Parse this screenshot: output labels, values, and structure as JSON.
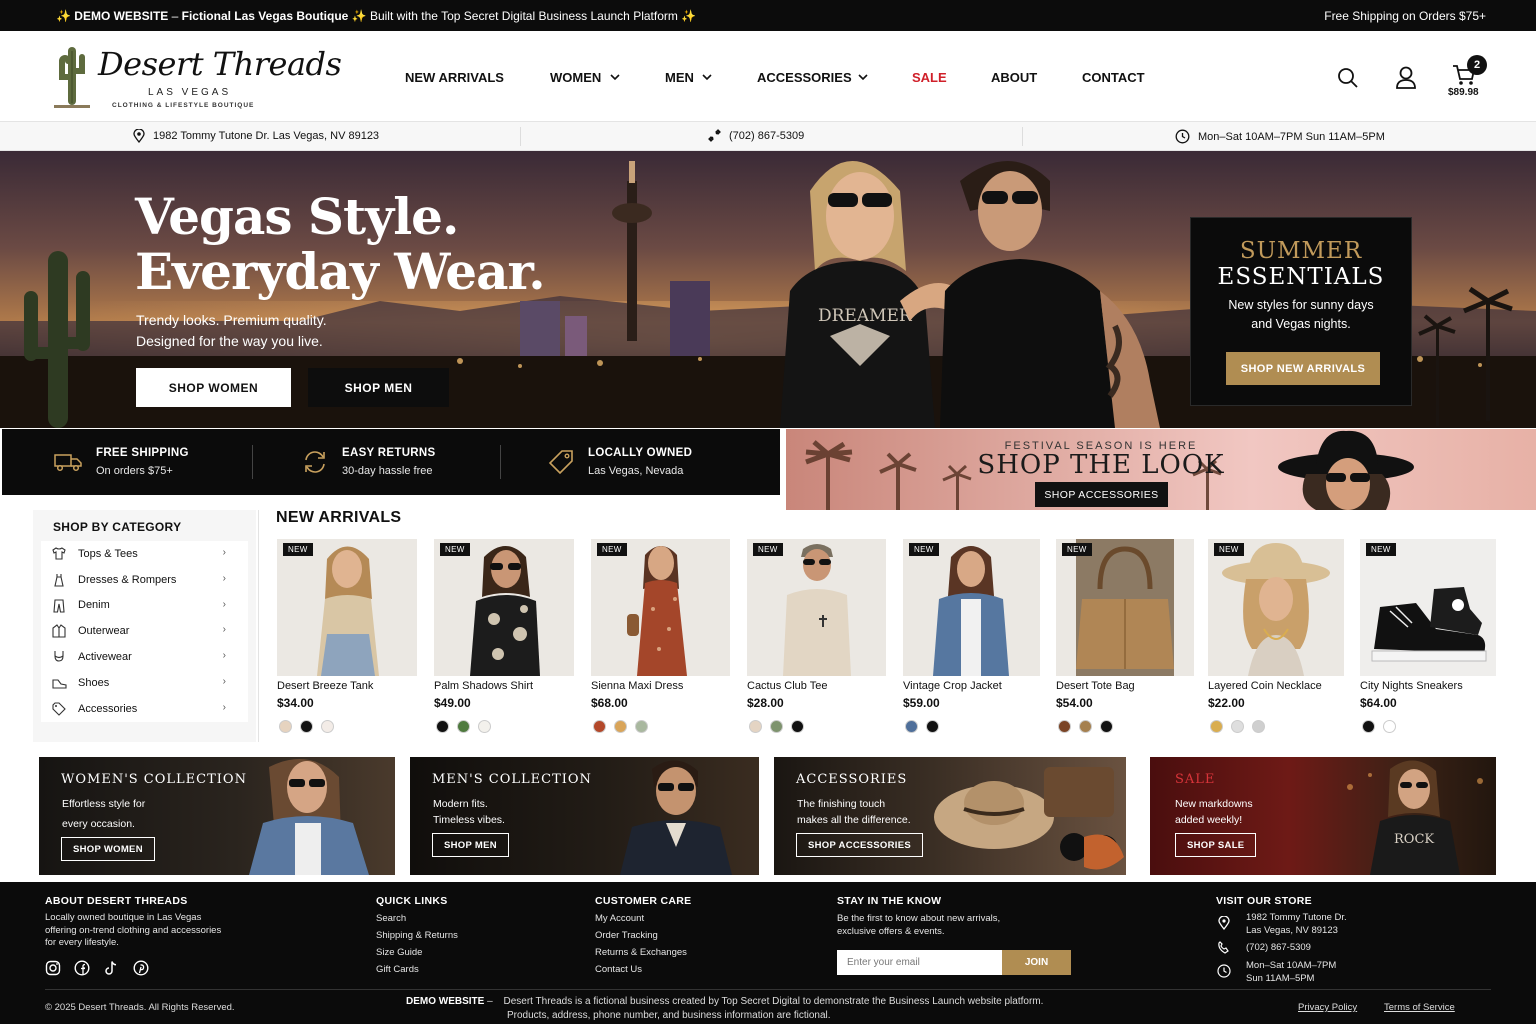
{
  "topbar": {
    "demo_prefix": "✨ DEMO WEBSITE",
    "demo_dash": " – ",
    "demo_name": "Fictional Las Vegas Boutique",
    "demo_suffix": " ✨ Built with the Top Secret Digital Business Launch Platform ✨",
    "shipping": "Free Shipping on Orders $75+"
  },
  "logo": {
    "script": "Desert Threads",
    "city": "LAS VEGAS",
    "tagline": "CLOTHING & LIFESTYLE BOUTIQUE"
  },
  "nav": [
    {
      "label": "NEW ARRIVALS",
      "dropdown": false
    },
    {
      "label": "WOMEN",
      "dropdown": true
    },
    {
      "label": "MEN",
      "dropdown": true
    },
    {
      "label": "ACCESSORIES",
      "dropdown": true
    },
    {
      "label": "SALE",
      "dropdown": false
    },
    {
      "label": "ABOUT",
      "dropdown": false
    },
    {
      "label": "CONTACT",
      "dropdown": false
    }
  ],
  "header_icons": [
    "search-icon",
    "user-icon",
    "cart-icon"
  ],
  "cart": {
    "count": "2",
    "total": "$89.98"
  },
  "info": {
    "address": "1982 Tommy Tutone Dr. Las Vegas, NV 89123",
    "phone": "(702) 867-5309",
    "hours": "Mon–Sat 10AM–7PM  Sun 11AM–5PM"
  },
  "hero": {
    "line1": "Vegas Style.",
    "line2": "Everyday Wear.",
    "tag1": "Trendy looks. Premium quality.",
    "tag2": "Designed for the way you live.",
    "btn_women": "SHOP WOMEN",
    "btn_men": "SHOP MEN",
    "shirt_text": "DREAMER"
  },
  "summer": {
    "t1": "SUMMER",
    "t2": "ESSENTIALS",
    "d1": "New styles for sunny days",
    "d2": "and Vegas nights.",
    "button": "SHOP NEW ARRIVALS"
  },
  "perks": [
    {
      "title": "FREE SHIPPING",
      "desc": "On orders $75+",
      "icon": "truck-icon"
    },
    {
      "title": "EASY RETURNS",
      "desc": "30-day hassle free",
      "icon": "returns-icon"
    },
    {
      "title": "LOCALLY OWNED",
      "desc": "Las Vegas, Nevada",
      "icon": "tag-icon"
    }
  ],
  "festival": {
    "kicker": "FESTIVAL SEASON IS HERE",
    "title": "SHOP THE LOOK",
    "button": "SHOP ACCESSORIES"
  },
  "categories": {
    "title": "SHOP BY CATEGORY",
    "items": [
      "Tops & Tees",
      "Dresses & Rompers",
      "Denim",
      "Outerwear",
      "Activewear",
      "Shoes",
      "Accessories"
    ]
  },
  "new_arrivals": {
    "title": "NEW ARRIVALS",
    "badge": "NEW",
    "products": [
      {
        "name": "Desert Breeze Tank",
        "price": "$34.00",
        "swatches": [
          "#e6d3bf",
          "#111111",
          "#f3ece7"
        ]
      },
      {
        "name": "Palm Shadows Shirt",
        "price": "$49.00",
        "swatches": [
          "#111111",
          "#4f7a3f",
          "#f3f1ec"
        ]
      },
      {
        "name": "Sienna Maxi Dress",
        "price": "$68.00",
        "swatches": [
          "#b3482a",
          "#d9a55a",
          "#a9b89f"
        ]
      },
      {
        "name": "Cactus Club Tee",
        "price": "$28.00",
        "swatches": [
          "#e4d4c3",
          "#7e936e",
          "#111111"
        ]
      },
      {
        "name": "Vintage Crop Jacket",
        "price": "$59.00",
        "swatches": [
          "#4f6f9a",
          "#111111"
        ]
      },
      {
        "name": "Desert Tote Bag",
        "price": "$54.00",
        "swatches": [
          "#7a4426",
          "#a5804f",
          "#111111"
        ]
      },
      {
        "name": "Layered Coin Necklace",
        "price": "$22.00",
        "swatches": [
          "#d9ad50",
          "#dedede",
          "#cfcfcf"
        ]
      },
      {
        "name": "City Nights Sneakers",
        "price": "$64.00",
        "swatches": [
          "#111111",
          "#ffffff"
        ]
      }
    ]
  },
  "collections": [
    {
      "title": "WOMEN'S COLLECTION",
      "d1": "Effortless style for",
      "d2": "every occasion.",
      "button": "SHOP WOMEN"
    },
    {
      "title": "MEN'S COLLECTION",
      "d1": "Modern fits.",
      "d2": "Timeless vibes.",
      "button": "SHOP MEN"
    },
    {
      "title": "ACCESSORIES",
      "d1": "The finishing touch",
      "d2": "makes all the difference.",
      "button": "SHOP ACCESSORIES"
    },
    {
      "title": "SALE",
      "d1": "New markdowns",
      "d2": "added weekly!",
      "button": "SHOP SALE",
      "shirt_text": "ROCK"
    }
  ],
  "footer": {
    "about_h": "ABOUT DESERT THREADS",
    "about_1": "Locally owned boutique in Las Vegas",
    "about_2": "offering on-trend clothing and accessories",
    "about_3": "for every lifestyle.",
    "social": [
      "instagram-icon",
      "facebook-icon",
      "tiktok-icon",
      "pinterest-icon"
    ],
    "quick_h": "QUICK LINKS",
    "quick": [
      "Search",
      "Shipping & Returns",
      "Size Guide",
      "Gift Cards"
    ],
    "care_h": "CUSTOMER CARE",
    "care": [
      "My Account",
      "Order Tracking",
      "Returns & Exchanges",
      "Contact Us"
    ],
    "know_h": "STAY IN THE KNOW",
    "know_1": "Be the first to know about new arrivals,",
    "know_2": "exclusive offers & events.",
    "email_placeholder": "Enter your email",
    "join": "JOIN",
    "visit_h": "VISIT OUR STORE",
    "addr_1": "1982 Tommy Tutone Dr.",
    "addr_2": "Las Vegas, NV 89123",
    "phone": "(702) 867-5309",
    "hours_1": "Mon–Sat 10AM–7PM",
    "hours_2": "Sun 11AM–5PM",
    "copyright": "© 2025 Desert Threads. All Rights Reserved.",
    "demo_label": "DEMO WEBSITE",
    "demo_dash": " – ",
    "demo_1": "Desert Threads is a fictional business created by Top Secret Digital to demonstrate the Business Launch website platform.",
    "demo_2": "Products, address, phone number, and business information are fictional.",
    "privacy": "Privacy Policy",
    "terms": "Terms of Service"
  }
}
